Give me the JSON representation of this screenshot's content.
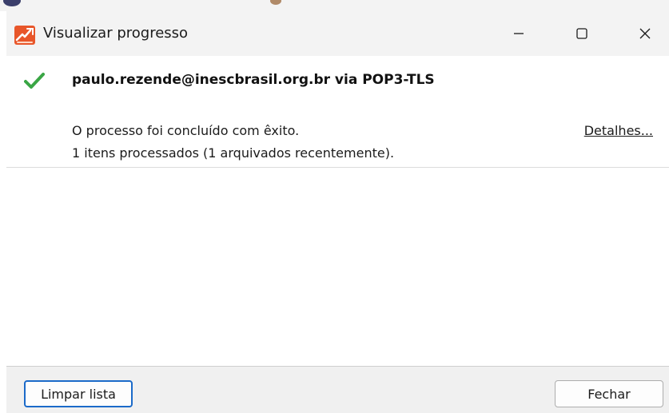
{
  "window": {
    "title": "Visualizar progresso",
    "controls": {
      "minimize_icon": "minimize-icon",
      "maximize_icon": "maximize-icon",
      "close_icon": "close-icon"
    }
  },
  "entries": [
    {
      "status_icon": "success-check-icon",
      "account": "paulo.rezende@inescbrasil.org.br via POP3-TLS",
      "status": "O processo foi concluído com êxito.",
      "count": "1 itens processados (1 arquivados recentemente).",
      "details_label": "Detalhes..."
    }
  ],
  "footer": {
    "clear_label": "Limpar lista",
    "close_label": "Fechar"
  },
  "colors": {
    "accent": "#1b6ac9",
    "success": "#3aa645",
    "app_icon": "#e8562a"
  }
}
